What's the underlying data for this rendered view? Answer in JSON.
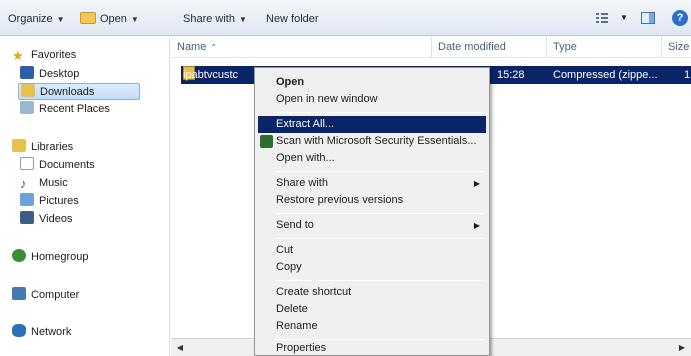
{
  "toolbar": {
    "organize": "Organize",
    "open": "Open",
    "share_with": "Share with",
    "new_folder": "New folder",
    "help": "?"
  },
  "nav": {
    "favorites": "Favorites",
    "desktop": "Desktop",
    "downloads": "Downloads",
    "recent_places": "Recent Places",
    "libraries": "Libraries",
    "documents": "Documents",
    "music": "Music",
    "pictures": "Pictures",
    "videos": "Videos",
    "homegroup": "Homegroup",
    "computer": "Computer",
    "network": "Network"
  },
  "columns": {
    "name": "Name",
    "date_modified": "Date modified",
    "type": "Type",
    "size": "Size"
  },
  "file": {
    "name": "ipabtvcustc",
    "time": "15:28",
    "type": "Compressed (zippe...",
    "size": "1"
  },
  "menu": {
    "open": "Open",
    "open_new_window": "Open in new window",
    "extract_all": "Extract All...",
    "scan": "Scan with Microsoft Security Essentials...",
    "open_with": "Open with...",
    "share_with": "Share with",
    "restore": "Restore previous versions",
    "send_to": "Send to",
    "cut": "Cut",
    "copy": "Copy",
    "create_shortcut": "Create shortcut",
    "delete": "Delete",
    "rename": "Rename",
    "properties": "Properties"
  },
  "colors": {
    "selection": "#0a246a",
    "menu_bg": "#f0f0f0",
    "toolbar_bg": "#dfe7f1"
  }
}
